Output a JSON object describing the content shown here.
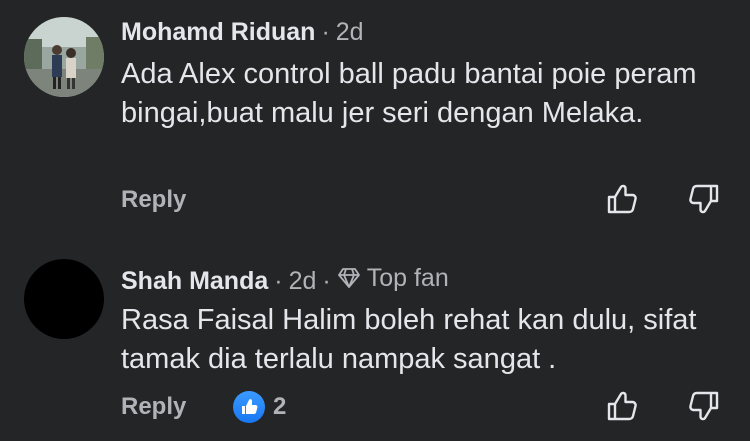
{
  "comments": [
    {
      "author": "Mohamd Riduan",
      "separator": "·",
      "time": "2d",
      "text": "Ada Alex control ball padu bantai poie peram bingai,buat malu jer seri dengan Melaka.",
      "reply_label": "Reply"
    },
    {
      "author": "Shah Manda",
      "separator": "·",
      "time": "2d",
      "badge_separator": "·",
      "badge": "Top fan",
      "text": "Rasa Faisal Halim boleh rehat kan dulu, sifat tamak dia terlalu nampak sangat .",
      "reply_label": "Reply",
      "reaction_count": "2"
    }
  ],
  "icons": {
    "upvote": "thumb-up-outline-icon",
    "downvote": "thumb-down-outline-icon",
    "top_fan": "diamond-icon",
    "like_reaction": "like-reaction-icon"
  },
  "colors": {
    "background": "#242526",
    "primary_text": "#e4e6eb",
    "secondary_text": "#b0b3b8",
    "like_blue": "#1877f2"
  }
}
